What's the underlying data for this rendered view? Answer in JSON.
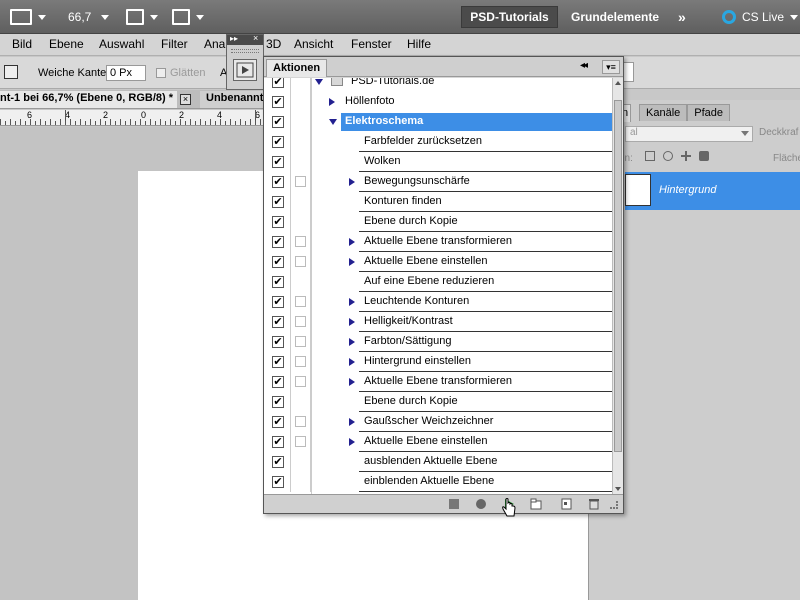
{
  "appbar": {
    "zoom": "66,7",
    "workspace_active": "PSD-Tutorials",
    "workspace_other": "Grundelemente",
    "more": "»",
    "cs_live": "CS Live"
  },
  "menubar": {
    "items": [
      "Bild",
      "Ebene",
      "Auswahl",
      "Filter",
      "Analyse",
      "3D",
      "Ansicht",
      "Fenster",
      "Hilfe"
    ],
    "visible_labels": [
      "Bild",
      "Ebene",
      "Auswahl",
      "Filter",
      "Ana",
      "3D",
      "Ansicht",
      "Fenster",
      "Hilfe"
    ]
  },
  "options": {
    "feather_label": "Weiche Kante:",
    "feather_value": "0 Px",
    "smooth_label": "Glätten",
    "a_label": "A"
  },
  "doctabs": {
    "tab1": "nt-1 bei 66,7% (Ebene 0, RGB/8) *",
    "tab1_close": "×",
    "tab2": "Unbenannt"
  },
  "ruler": {
    "numbers": [
      "6",
      "4",
      "2",
      "0",
      "2",
      "4",
      "6"
    ]
  },
  "right_panel": {
    "tab_partial": "n",
    "tabs": [
      "Kanäle",
      "Pfade"
    ],
    "blend_partial": "al",
    "opacity_partial": "Deckkraf",
    "lock_partial": "en:",
    "fill_partial": "Fläche",
    "layer_name": "Hintergrund"
  },
  "actions_panel": {
    "tab_label": "Aktionen",
    "collapse": "◂◂",
    "menu": "▾≡",
    "rows": [
      {
        "label": "PSD-Tutorials.de",
        "level": 0,
        "expander": "down",
        "folder": true,
        "dialog": false,
        "selected": false
      },
      {
        "label": "Höllenfoto",
        "level": 1,
        "expander": "right",
        "folder": false,
        "dialog": false,
        "selected": false
      },
      {
        "label": "Elektroschema",
        "level": 1,
        "expander": "down",
        "folder": false,
        "dialog": false,
        "selected": true
      },
      {
        "label": "Farbfelder zurücksetzen",
        "level": 2,
        "expander": "",
        "folder": false,
        "dialog": false,
        "selected": false
      },
      {
        "label": "Wolken",
        "level": 2,
        "expander": "",
        "folder": false,
        "dialog": false,
        "selected": false
      },
      {
        "label": "Bewegungsunschärfe",
        "level": 2,
        "expander": "right",
        "folder": false,
        "dialog": true,
        "selected": false
      },
      {
        "label": "Konturen finden",
        "level": 2,
        "expander": "",
        "folder": false,
        "dialog": false,
        "selected": false
      },
      {
        "label": "Ebene durch Kopie",
        "level": 2,
        "expander": "",
        "folder": false,
        "dialog": false,
        "selected": false
      },
      {
        "label": "Aktuelle Ebene transformieren",
        "level": 2,
        "expander": "right",
        "folder": false,
        "dialog": true,
        "selected": false
      },
      {
        "label": "Aktuelle Ebene einstellen",
        "level": 2,
        "expander": "right",
        "folder": false,
        "dialog": true,
        "selected": false
      },
      {
        "label": "Auf eine Ebene reduzieren",
        "level": 2,
        "expander": "",
        "folder": false,
        "dialog": false,
        "selected": false
      },
      {
        "label": "Leuchtende Konturen",
        "level": 2,
        "expander": "right",
        "folder": false,
        "dialog": true,
        "selected": false
      },
      {
        "label": "Helligkeit/Kontrast",
        "level": 2,
        "expander": "right",
        "folder": false,
        "dialog": true,
        "selected": false
      },
      {
        "label": "Farbton/Sättigung",
        "level": 2,
        "expander": "right",
        "folder": false,
        "dialog": true,
        "selected": false
      },
      {
        "label": "Hintergrund einstellen",
        "level": 2,
        "expander": "right",
        "folder": false,
        "dialog": true,
        "selected": false
      },
      {
        "label": "Aktuelle Ebene transformieren",
        "level": 2,
        "expander": "right",
        "folder": false,
        "dialog": true,
        "selected": false
      },
      {
        "label": "Ebene durch Kopie",
        "level": 2,
        "expander": "",
        "folder": false,
        "dialog": false,
        "selected": false
      },
      {
        "label": "Gaußscher Weichzeichner",
        "level": 2,
        "expander": "right",
        "folder": false,
        "dialog": true,
        "selected": false
      },
      {
        "label": "Aktuelle Ebene einstellen",
        "level": 2,
        "expander": "right",
        "folder": false,
        "dialog": true,
        "selected": false
      },
      {
        "label": "ausblenden Aktuelle Ebene",
        "level": 2,
        "expander": "",
        "folder": false,
        "dialog": false,
        "selected": false
      },
      {
        "label": "einblenden Aktuelle Ebene",
        "level": 2,
        "expander": "",
        "folder": false,
        "dialog": false,
        "selected": false
      }
    ],
    "footer_buttons": [
      "stop-icon",
      "record-icon",
      "play-icon",
      "new-set-icon",
      "new-action-icon",
      "trash-icon"
    ]
  },
  "colors": {
    "selection": "#3d8ee6",
    "expander": "#222090"
  }
}
